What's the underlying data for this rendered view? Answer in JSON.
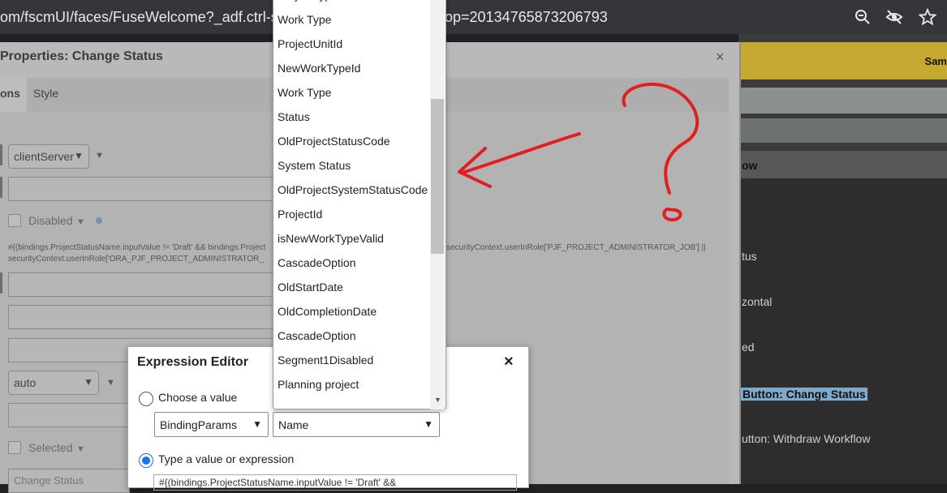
{
  "browser": {
    "url_left": "om/fscmUI/faces/FuseWelcome?_adf.ctrl-sta",
    "url_right": "op=20134765873206793",
    "icons": [
      "zoom-icon",
      "eye-off-icon",
      "star-icon"
    ]
  },
  "properties_dialog": {
    "title": "Properties: Change Status",
    "close": "×",
    "tabs": [
      "ons",
      "Style"
    ],
    "select_client_server": "clientServer",
    "disabled_label": "Disabled",
    "expression_line1": "#{(bindings.ProjectStatusName.inputValue != 'Draft' && bindings.Project",
    "expression_line1_right": "securityContext.userInRole['PJF_PROJECT_ADMINISTRATOR_JOB'] ||",
    "expression_line2": "securityContext.userInRole['ORA_PJF_PROJECT_ADMINISTRATOR_",
    "select_auto": "auto",
    "selected_label": "Selected",
    "text_value": "Change Status"
  },
  "right_panel": {
    "yellow_text": "Sam",
    "header": "ow",
    "items": [
      "tus",
      "zontal",
      "ed",
      "Button: Change Status",
      "utton: Withdraw Workflow"
    ]
  },
  "expression_editor": {
    "title": "Expression Editor",
    "close": "×",
    "choose_label": "Choose a value",
    "binding_select": "BindingParams",
    "name_select": "Name",
    "type_label": "Type a value or expression",
    "expression_text": "#{(bindings.ProjectStatusName.inputValue != 'Draft' &&"
  },
  "dropdown_items": [
    "ProjectTypeId",
    "Work Type",
    "ProjectUnitId",
    "NewWorkTypeId",
    "Work Type",
    "Status",
    "OldProjectStatusCode",
    "System Status",
    "OldProjectSystemStatusCode",
    "ProjectId",
    "isNewWorkTypeValid",
    "CascadeOption",
    "OldStartDate",
    "OldCompletionDate",
    "CascadeOption",
    "Segment1Disabled",
    "Planning project"
  ],
  "colors": {
    "annotation_red": "#e02020",
    "yellow_bar": "#c6a931",
    "radio_blue": "#1a73e8"
  }
}
